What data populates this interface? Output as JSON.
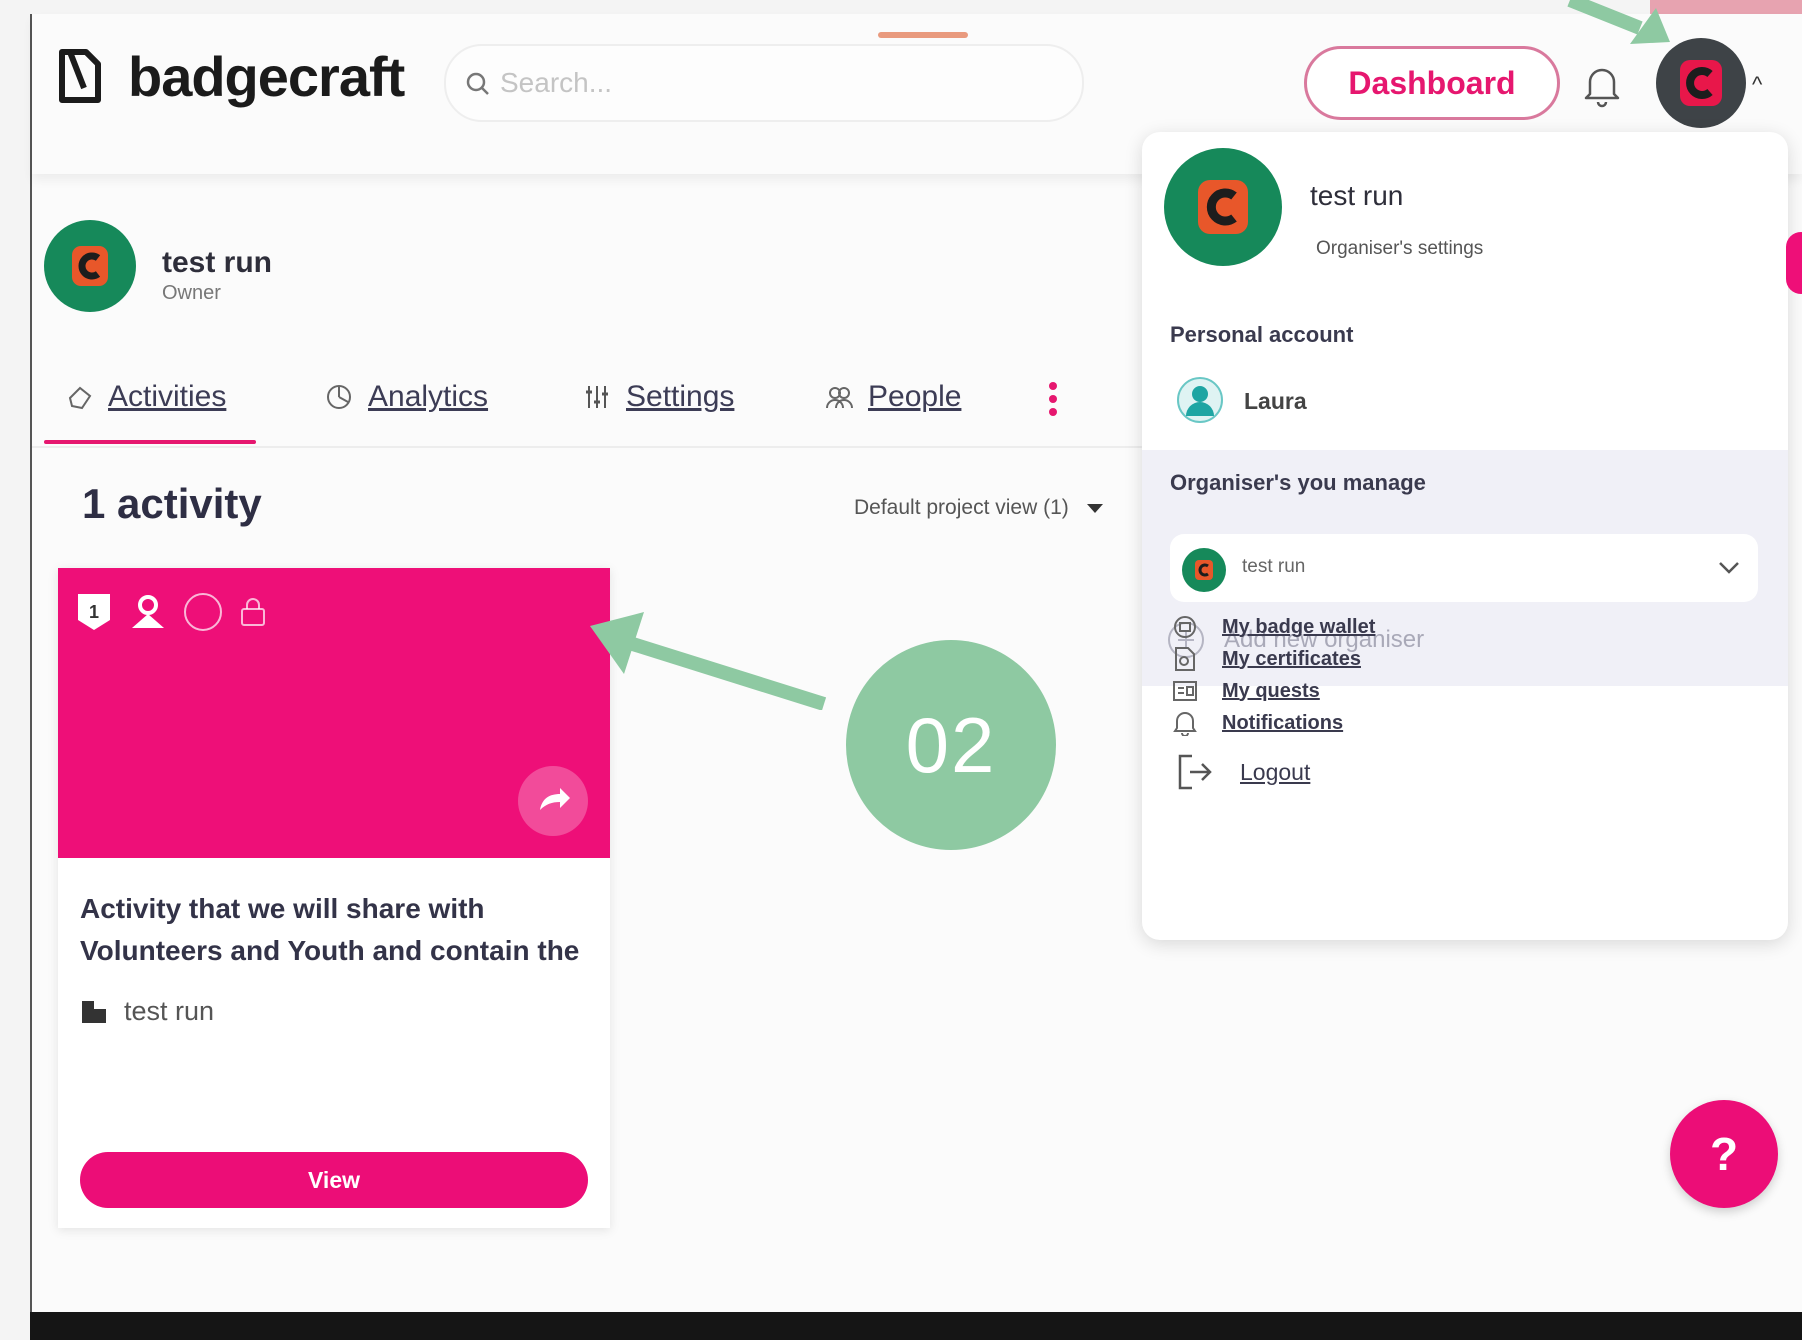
{
  "header": {
    "logo_text": "badgecraft",
    "search_placeholder": "Search...",
    "dashboard_label": "Dashboard"
  },
  "organiser": {
    "name": "test run",
    "role": "Owner"
  },
  "tabs": [
    {
      "label": "Activities",
      "icon": "activities-icon",
      "active": true
    },
    {
      "label": "Analytics",
      "icon": "analytics-icon"
    },
    {
      "label": "Settings",
      "icon": "settings-sliders-icon"
    },
    {
      "label": "People",
      "icon": "people-icon"
    }
  ],
  "activities": {
    "count_label": "1 activity",
    "view_select": "Default project view (1)",
    "card": {
      "badge_number": "1",
      "title": "Activity that we will share with Volunteers and Youth and contain the",
      "organiser": "test run",
      "view_label": "View",
      "image_color": "#ee0f78"
    }
  },
  "callout": {
    "label": "02",
    "color": "#8ec9a2"
  },
  "dropdown": {
    "name": "test run",
    "settings_label": "Organiser's settings",
    "personal_account_heading": "Personal account",
    "personal_account_name": "Laura",
    "manage_heading": "Organiser's you manage",
    "selected_organiser": "test run",
    "add_organiser_label": "Add new organiser",
    "links": [
      {
        "label": "My badge wallet",
        "icon": "wallet-icon"
      },
      {
        "label": "My certificates",
        "icon": "certificate-icon"
      },
      {
        "label": "My quests",
        "icon": "quests-icon"
      },
      {
        "label": "Notifications",
        "icon": "bell-icon"
      }
    ],
    "logout_label": "Logout"
  },
  "help_label": "?",
  "colors": {
    "accent": "#e6176f",
    "avatar_green": "#16895a"
  }
}
